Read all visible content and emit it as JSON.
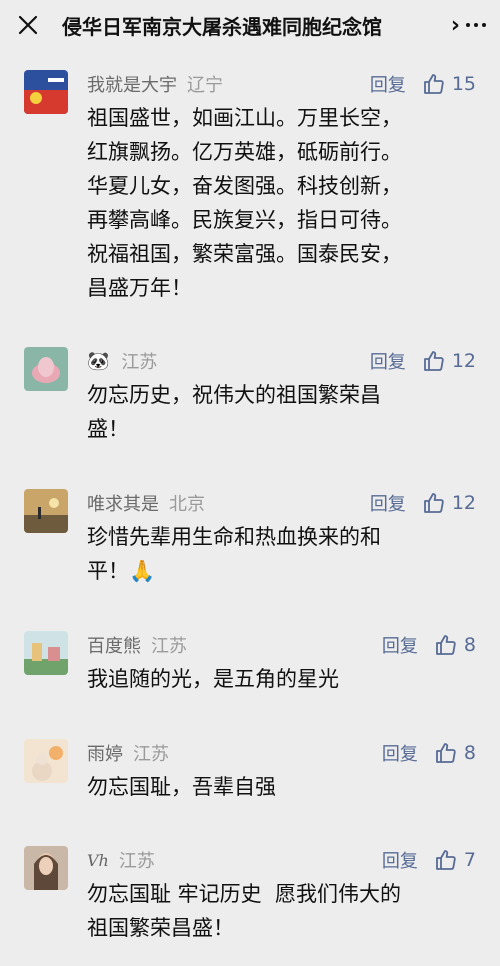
{
  "header": {
    "title": "侵华日军南京大屠杀遇难同胞纪念馆",
    "chevron": "›"
  },
  "comments": [
    {
      "name": "我就是大宇",
      "location": "辽宁",
      "reply": "回复",
      "likes": "15",
      "text": "祖国盛世，如画江山。万里长空，\n红旗飘扬。亿万英雄，砥砺前行。\n华夏儿女，奋发图强。科技创新，\n再攀高峰。民族复兴，指日可待。\n祝福祖国，繁荣富强。国泰民安，\n昌盛万年！"
    },
    {
      "name": "🐼",
      "location": "江苏",
      "reply": "回复",
      "likes": "12",
      "text": "勿忘历史，祝伟大的祖国繁荣昌\n盛！"
    },
    {
      "name": "唯求其是",
      "location": "北京",
      "reply": "回复",
      "likes": "12",
      "text": "珍惜先辈用生命和热血换来的和\n平！🙏"
    },
    {
      "name": "百度熊",
      "location": "江苏",
      "reply": "回复",
      "likes": "8",
      "text": "我追随的光，是五角的星光"
    },
    {
      "name": "雨婷",
      "location": "江苏",
      "reply": "回复",
      "likes": "8",
      "text": "勿忘国耻，吾辈自强"
    },
    {
      "name": "Vh",
      "location": "江苏",
      "reply": "回复",
      "likes": "7",
      "text": "勿忘国耻 牢记历史  愿我们伟大的\n祖国繁荣昌盛！"
    }
  ]
}
